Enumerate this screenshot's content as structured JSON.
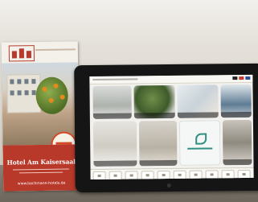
{
  "scene": {
    "description_colors": {
      "accent": "#b8382a",
      "tablet_bezel": "#151515",
      "screen_bg": "#f2f1ed"
    }
  },
  "brochure": {
    "title": "Hotel Am Kaisersaal",
    "website": "www.bachmann-hotels.de",
    "seal_icon": "award-seal-icon",
    "logo_icon": "hotel-logo-icon"
  },
  "tablet": {
    "tiles": [
      {
        "icon": "photo-dining-icon"
      },
      {
        "icon": "photo-plant-icon"
      },
      {
        "icon": "photo-people-icon"
      },
      {
        "icon": "photo-computer-icon"
      },
      {
        "icon": "photo-restaurant-icon"
      },
      {
        "icon": "photo-lobby-icon"
      },
      {
        "icon": "bachmann-logo-icon"
      },
      {
        "icon": "photo-room-icon"
      }
    ],
    "nav_count": 10
  }
}
